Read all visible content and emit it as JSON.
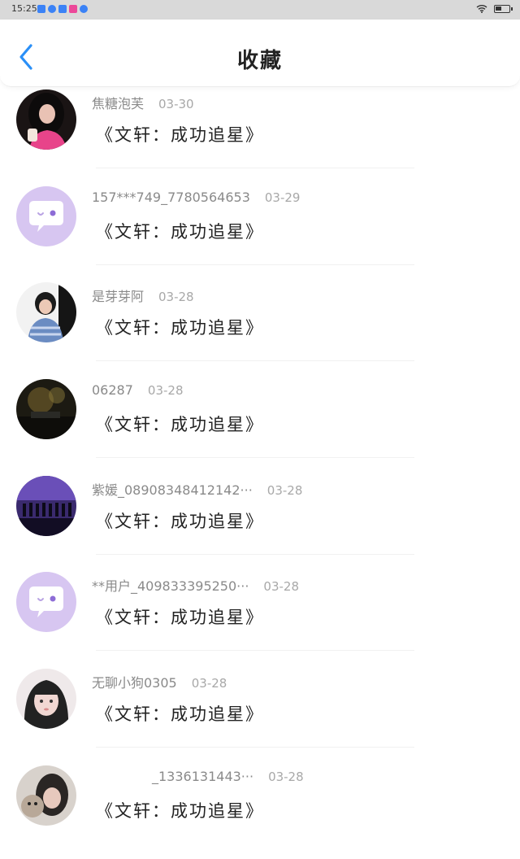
{
  "status_bar": {
    "time": "15:25",
    "icon_colors": [
      "#3b82f6",
      "#3b82f6",
      "#3b82f6",
      "#ec4899",
      "#3b82f6"
    ]
  },
  "header": {
    "title": "收藏",
    "accent": "#2a8ff7"
  },
  "items": [
    {
      "user": "焦糖泡芙",
      "date": "03-30",
      "content": "《文轩：成功追星》",
      "avatar": "photo-dark-pink"
    },
    {
      "user": "157***749_7780564653",
      "date": "03-29",
      "content": "《文轩：成功追星》",
      "avatar": "default-chat"
    },
    {
      "user": "是芽芽阿",
      "date": "03-28",
      "content": "《文轩：成功追星》",
      "avatar": "photo-boy-sweater"
    },
    {
      "user": "06287",
      "date": "03-28",
      "content": "《文轩：成功追星》",
      "avatar": "photo-stage-dark"
    },
    {
      "user": "紫媛_08908348412142···",
      "date": "03-28",
      "content": "《文轩：成功追星》",
      "avatar": "photo-concert-purple"
    },
    {
      "user": "**用户_409833395250···",
      "date": "03-28",
      "content": "《文轩：成功追星》",
      "avatar": "default-chat"
    },
    {
      "user": "无聊小狗0305",
      "date": "03-28",
      "content": "《文轩：成功追星》",
      "avatar": "photo-girl-face"
    },
    {
      "user": "_1336131443···",
      "date": "03-28",
      "content": "《文轩：成功追星》",
      "avatar": "photo-girl-cat"
    }
  ]
}
